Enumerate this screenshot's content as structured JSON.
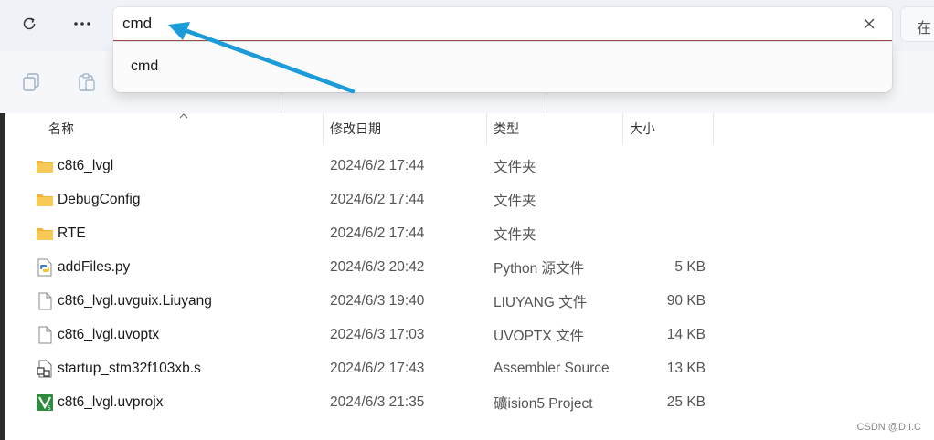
{
  "address_bar": {
    "value": "cmd"
  },
  "search_box": {
    "text": "在"
  },
  "suggestions": [
    {
      "label": "cmd"
    }
  ],
  "columns": [
    {
      "label": "名称"
    },
    {
      "label": "修改日期"
    },
    {
      "label": "类型"
    },
    {
      "label": "大小"
    }
  ],
  "files": [
    {
      "name": "c8t6_lvgl",
      "date": "2024/6/2 17:44",
      "type": "文件夹",
      "size": "",
      "icon": "folder-icon"
    },
    {
      "name": "DebugConfig",
      "date": "2024/6/2 17:44",
      "type": "文件夹",
      "size": "",
      "icon": "folder-icon"
    },
    {
      "name": "RTE",
      "date": "2024/6/2 17:44",
      "type": "文件夹",
      "size": "",
      "icon": "folder-icon"
    },
    {
      "name": "addFiles.py",
      "date": "2024/6/3 20:42",
      "type": "Python 源文件",
      "size": "5 KB",
      "icon": "python-file-icon"
    },
    {
      "name": "c8t6_lvgl.uvguix.Liuyang",
      "date": "2024/6/3 19:40",
      "type": "LIUYANG 文件",
      "size": "90 KB",
      "icon": "generic-file-icon"
    },
    {
      "name": "c8t6_lvgl.uvoptx",
      "date": "2024/6/3 17:03",
      "type": "UVOPTX 文件",
      "size": "14 KB",
      "icon": "generic-file-icon"
    },
    {
      "name": "startup_stm32f103xb.s",
      "date": "2024/6/2 17:43",
      "type": "Assembler Source",
      "size": "13 KB",
      "icon": "assembler-file-icon"
    },
    {
      "name": "c8t6_lvgl.uvprojx",
      "date": "2024/6/3 21:35",
      "type": "礦ision5 Project",
      "size": "25 KB",
      "icon": "keil-project-icon"
    }
  ],
  "watermark": "CSDN @D.I.C",
  "colors": {
    "accent_underline": "#9c4f45",
    "annotation_arrow": "#1b9bd9",
    "folder": "#f5c04a"
  }
}
